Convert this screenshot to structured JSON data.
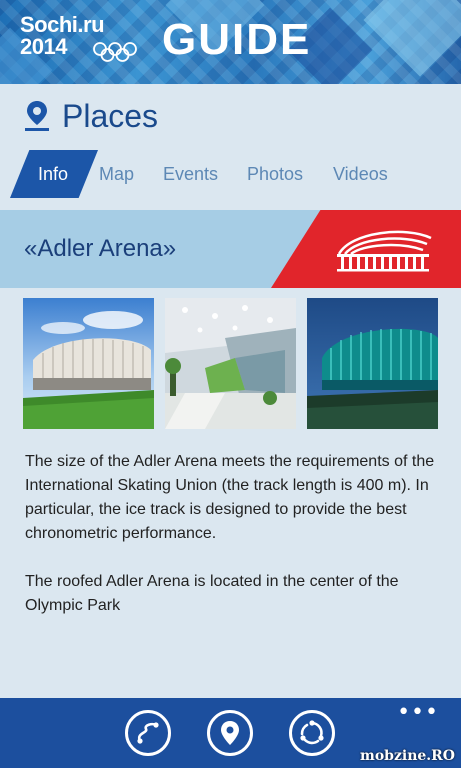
{
  "banner": {
    "brand_line1": "Sochi.ru",
    "brand_line2": "2014",
    "title": "GUIDE",
    "rings_icon": "olympic-rings-icon"
  },
  "header": {
    "title": "Places",
    "icon": "map-pin-icon"
  },
  "tabs": [
    {
      "label": "Info",
      "active": true
    },
    {
      "label": "Map",
      "active": false
    },
    {
      "label": "Events",
      "active": false
    },
    {
      "label": "Photos",
      "active": false
    },
    {
      "label": "Videos",
      "active": false
    }
  ],
  "venue": {
    "name": "«Adler Arena»",
    "icon": "arena-building-icon"
  },
  "photos": [
    {
      "subject": "arena-exterior-day"
    },
    {
      "subject": "arena-interior-hall"
    },
    {
      "subject": "arena-exterior-night"
    }
  ],
  "description": {
    "paragraph1": "The size of the Adler Arena meets the requirements of the International Skating Union (the track length is 400 m). In particular, the ice track is designed to provide the best chronometric performance.",
    "paragraph2": "The roofed Adler Arena is located in the center of the Olympic Park"
  },
  "appbar": {
    "buttons": [
      "route-icon",
      "location-pin-icon",
      "share-icon"
    ],
    "more_label": "•••"
  },
  "watermark": "mobzine.RO",
  "colors": {
    "accent": "#1c56a8",
    "title": "#1a4a8c",
    "venue_band": "#a6cde5",
    "venue_red": "#e1252b",
    "appbar": "#1c4f9e",
    "background": "#dbe7f0"
  }
}
